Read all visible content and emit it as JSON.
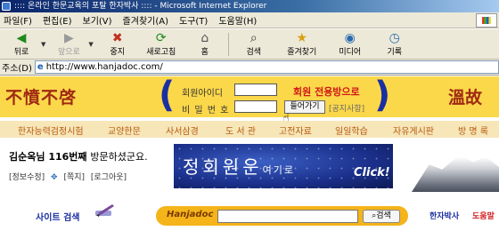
{
  "window": {
    "title": ":::: 온라인 한문교육의 포탈 한자박사 :::: - Microsoft Internet Explorer"
  },
  "menu": [
    "파일(F)",
    "편집(E)",
    "보기(V)",
    "즐겨찾기(A)",
    "도구(T)",
    "도움말(H)"
  ],
  "toolbar": {
    "back": "뒤로",
    "forward": "앞으로",
    "stop": "중지",
    "refresh": "새로고침",
    "home": "홈",
    "search": "검색",
    "favorites": "즐겨찾기",
    "media": "미디어",
    "history": "기록"
  },
  "address": {
    "label": "주소(D)",
    "url": "http://www.hanjadoc.com/"
  },
  "header": {
    "logo_left": "不憤不啓",
    "logo_right": "溫故",
    "id_label": "회원아이디",
    "pw_label": "비 밀 번 호",
    "members_only": "회원 전용방으로",
    "login_button": "들어가기",
    "notice_link": "[공지사항]"
  },
  "nav": [
    "한자능력검정시험",
    "교양한문",
    "사서삼경",
    "도 서 관",
    "고전자료",
    "일일학습",
    "자유게시판",
    "방 명 록"
  ],
  "welcome": {
    "name": "김순옥님",
    "count": "116번째",
    "rest": "방문하셨군요."
  },
  "user_links": [
    "[정보수정]",
    "[쪽지]",
    "[로그아웃]"
  ],
  "banner": {
    "text_big": "정회원운",
    "text_small": "여기로",
    "click": "Click!"
  },
  "search": {
    "site_label": "사이트 검색",
    "brand": "Hanjadoc",
    "button": "검색"
  },
  "corner": {
    "link1": "한자박사",
    "link2": "도움말"
  }
}
